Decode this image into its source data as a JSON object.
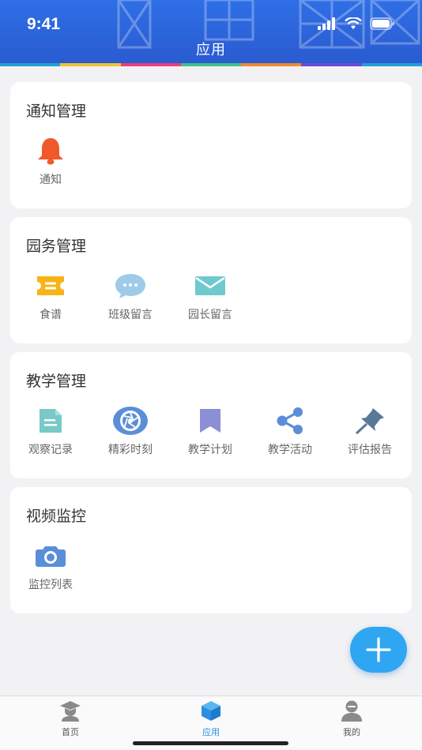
{
  "status": {
    "time": "9:41"
  },
  "header": {
    "title": "应用",
    "strip_colors": [
      "#1ea0d8",
      "#f2c230",
      "#e8407a",
      "#43c08a",
      "#f08a30",
      "#6a4ad6",
      "#1ea0d8"
    ]
  },
  "sections": [
    {
      "title": "通知管理",
      "items": [
        {
          "label": "通知",
          "icon": "bell-icon",
          "color": "#f0592a"
        }
      ]
    },
    {
      "title": "园务管理",
      "items": [
        {
          "label": "食谱",
          "icon": "recipe-icon",
          "color": "#f7b317"
        },
        {
          "label": "班级留言",
          "icon": "chat-bubble-icon",
          "color": "#9fcbe8"
        },
        {
          "label": "园长留言",
          "icon": "envelope-icon",
          "color": "#6fc9cf"
        }
      ]
    },
    {
      "title": "教学管理",
      "items": [
        {
          "label": "观察记录",
          "icon": "document-icon",
          "color": "#79c9c9"
        },
        {
          "label": "精彩时刻",
          "icon": "aperture-icon",
          "color": "#5a8fd8"
        },
        {
          "label": "教学计划",
          "icon": "bookmark-icon",
          "color": "#8a8fd6"
        },
        {
          "label": "教学活动",
          "icon": "share-icon",
          "color": "#5b8ed6"
        },
        {
          "label": "评估报告",
          "icon": "pushpin-icon",
          "color": "#5a7898"
        }
      ]
    },
    {
      "title": "视频监控",
      "items": [
        {
          "label": "监控列表",
          "icon": "camera-icon",
          "color": "#5a8fd8"
        }
      ]
    }
  ],
  "fab": {
    "icon": "plus-icon",
    "color": "#2fa6f2"
  },
  "tabbar": {
    "tabs": [
      {
        "label": "首页",
        "icon": "student-icon"
      },
      {
        "label": "应用",
        "icon": "cube-icon",
        "active": true
      },
      {
        "label": "我的",
        "icon": "person-icon"
      }
    ],
    "active_color": "#2a8fe0"
  }
}
